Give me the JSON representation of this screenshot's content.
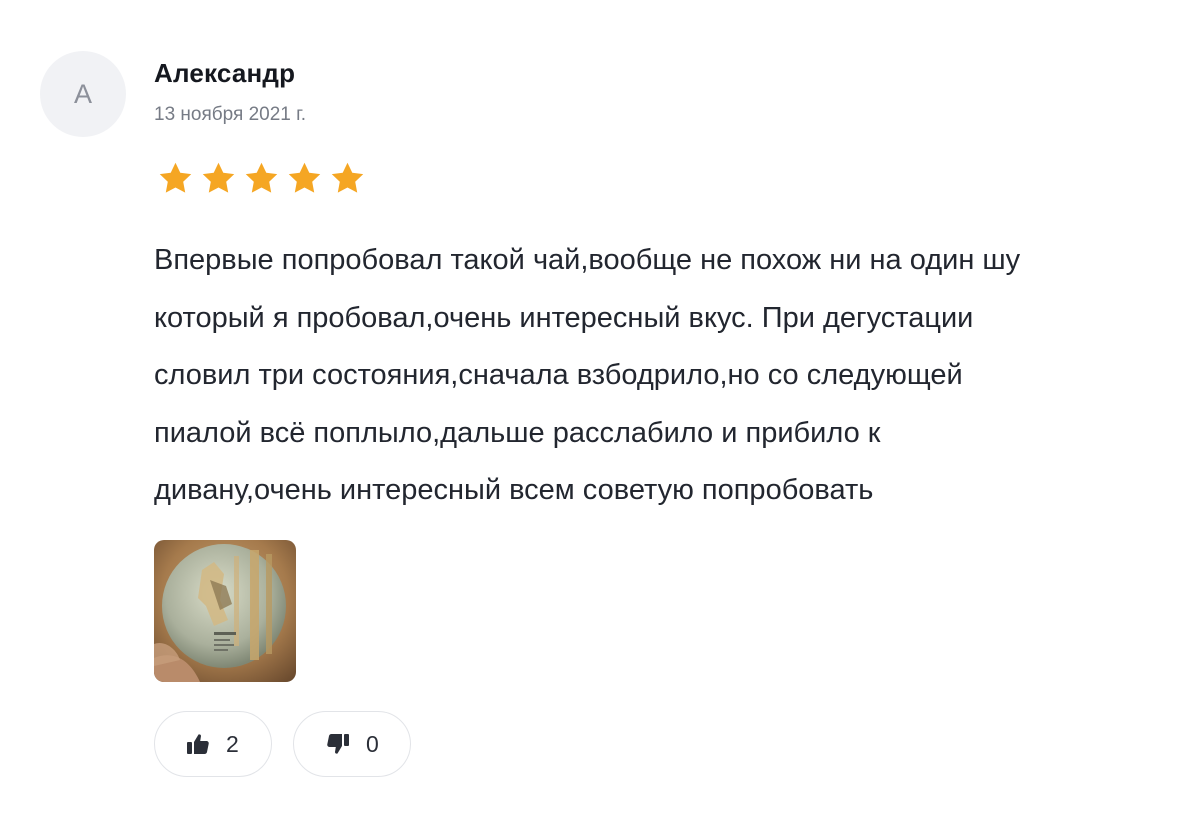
{
  "review": {
    "avatar_letter": "А",
    "author": "Александр",
    "date": "13 ноября 2021 г.",
    "rating": 5,
    "rating_max": 5,
    "star_color": "#f5a623",
    "lines": [
      "Впервые попробовал такой чай,вообще не похож ни на один шу",
      "который я пробовал,очень интересный вкус. При дегустации",
      "словил три состояния,сначала взбодрило,но со следующей",
      "пиалой всё поплыло,дальше расслабило и прибило к",
      "дивану,очень интересный всем советую попробовать"
    ],
    "photo_thumbnail": "tea-cake-photo"
  },
  "votes": {
    "likes": "2",
    "dislikes": "0",
    "like_icon": "thumbs-up-icon",
    "dislike_icon": "thumbs-down-icon"
  }
}
